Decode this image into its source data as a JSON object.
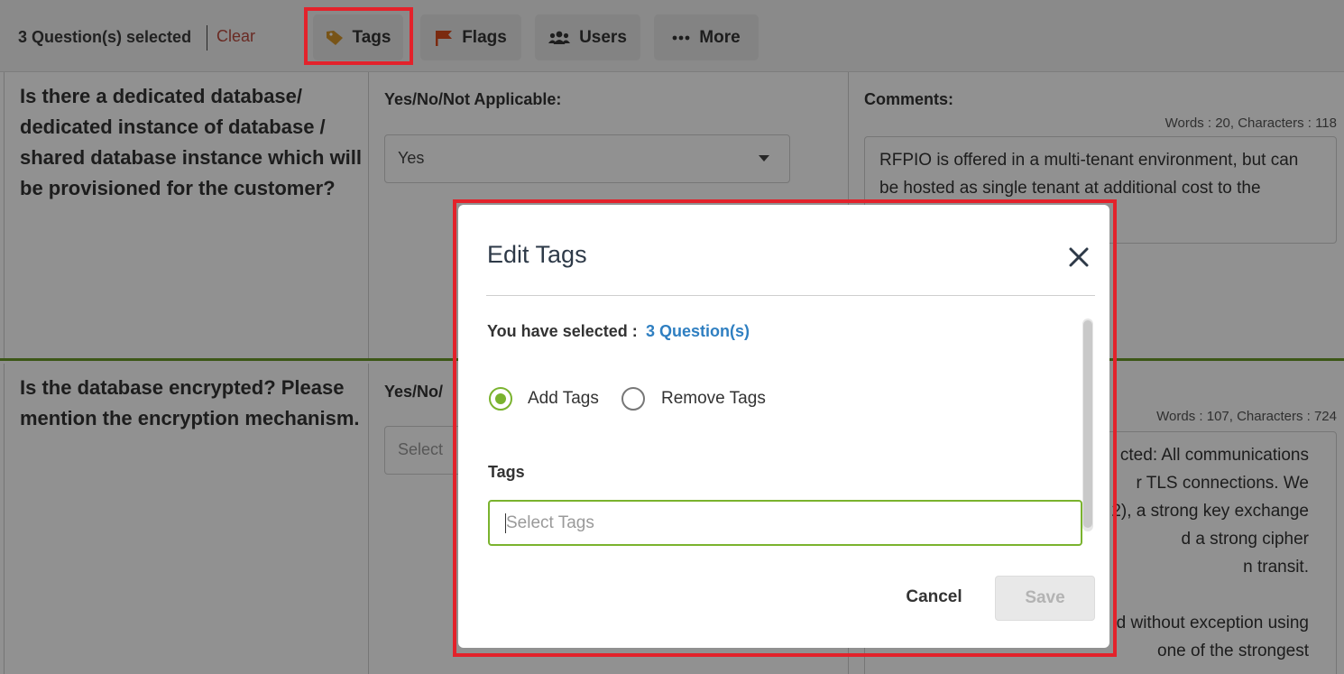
{
  "toolbar": {
    "selected_text": "3 Question(s) selected",
    "clear_label": "Clear",
    "tags_label": "Tags",
    "flags_label": "Flags",
    "users_label": "Users",
    "more_label": "More"
  },
  "rows": [
    {
      "question": "Is there a dedicated database/ dedicated instance of database / shared database instance which will be provisioned for the customer?",
      "answer_label": "Yes/No/Not Applicable:",
      "answer_value": "Yes",
      "comments_label": "Comments:",
      "comment_counter": "Words : 20, Characters : 118",
      "comment_text": "RFPIO is offered in a multi-tenant environment, but can be hosted as single tenant at additional cost to the"
    },
    {
      "question": "Is the database encrypted? Please mention the encryption mechanism.",
      "answer_label": "Yes/No/",
      "answer_placeholder": "Select",
      "comment_counter": "Words : 107, Characters : 724",
      "comment_lines": [
        "cted:  All communications",
        "r TLS connections.  We",
        "2), a strong key exchange",
        "d a strong cipher",
        "n transit.",
        "",
        "d without exception using",
        "one of the strongest"
      ]
    }
  ],
  "modal": {
    "title": "Edit Tags",
    "you_selected_label": "You have selected :",
    "selected_count": "3 Question(s)",
    "options": {
      "add_label": "Add Tags",
      "remove_label": "Remove Tags",
      "selected": "add"
    },
    "tags_label": "Tags",
    "tags_placeholder": "Select Tags",
    "cancel_label": "Cancel",
    "save_label": "Save"
  },
  "colors": {
    "highlight": "#e3222b",
    "accent_green": "#7ab32e",
    "link_blue": "#2f7fc1",
    "clear_red": "#b94a3e",
    "flag_orange": "#d84a1b",
    "tag_gold": "#d4952a"
  },
  "icons": {
    "tags": "tag-icon",
    "flags": "flag-icon",
    "users": "users-icon",
    "more": "ellipsis-icon",
    "close": "close-icon",
    "dropdown": "caret-down-icon"
  }
}
